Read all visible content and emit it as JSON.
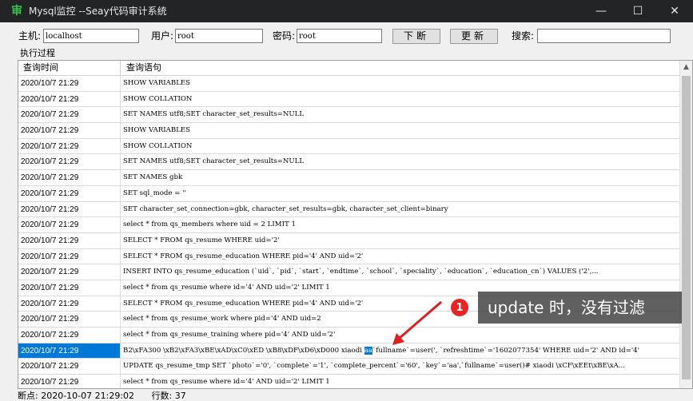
{
  "window": {
    "title": "Mysql监控 --Seay代码审计系统",
    "app_icon": "审",
    "minimize": "—",
    "maximize": "☐",
    "close": "✕"
  },
  "toolbar": {
    "host_label": "主机:",
    "host_value": "localhost",
    "user_label": "用户:",
    "user_value": "root",
    "password_label": "密码:",
    "password_value": "root",
    "disconnect_button": "下断",
    "update_button": "更新",
    "search_label": "搜索:",
    "search_value": ""
  },
  "section_title": "执行过程",
  "grid": {
    "columns": [
      "查询时间",
      "查询语句"
    ],
    "rows": [
      {
        "time": "2020/10/7 21:29",
        "query": "SHOW VARIABLES"
      },
      {
        "time": "2020/10/7 21:29",
        "query": "SHOW COLLATION"
      },
      {
        "time": "2020/10/7 21:29",
        "query": "SET NAMES utf8;SET character_set_results=NULL"
      },
      {
        "time": "2020/10/7 21:29",
        "query": "SHOW VARIABLES"
      },
      {
        "time": "2020/10/7 21:29",
        "query": "SHOW COLLATION"
      },
      {
        "time": "2020/10/7 21:29",
        "query": "SET NAMES utf8;SET character_set_results=NULL"
      },
      {
        "time": "2020/10/7 21:29",
        "query": "SET NAMES gbk"
      },
      {
        "time": "2020/10/7 21:29",
        "query": "SET sql_mode = ''"
      },
      {
        "time": "2020/10/7 21:29",
        "query": "SET character_set_connection=gbk, character_set_results=gbk, character_set_client=binary"
      },
      {
        "time": "2020/10/7 21:29",
        "query": "select * from qs_members where uid = 2 LIMIT 1"
      },
      {
        "time": "2020/10/7 21:29",
        "query": "SELECT * FROM qs_resume WHERE uid='2'"
      },
      {
        "time": "2020/10/7 21:29",
        "query": "SELECT * FROM qs_resume_education WHERE  pid='4' AND uid='2'"
      },
      {
        "time": "2020/10/7 21:29",
        "query": "INSERT INTO qs_resume_education (`uid`, `pid`, `start`, `endtime`, `school`, `speciality`, `education`, `education_cn`) VALUES ('2',..."
      },
      {
        "time": "2020/10/7 21:29",
        "query": "select * from qs_resume where id='4'  AND uid='2' LIMIT 1"
      },
      {
        "time": "2020/10/7 21:29",
        "query": "SELECT * FROM qs_resume_education WHERE  pid='4' AND uid='2'"
      },
      {
        "time": "2020/10/7 21:29",
        "query": "select * from qs_resume_work where pid='4' AND uid=2"
      },
      {
        "time": "2020/10/7 21:29",
        "query": "select * from qs_resume_training where pid='4' AND  uid='2'"
      },
      {
        "time": "2020/10/7 21:29",
        "query_before": "B2\\xFA300 \\xB2\\xFA3\\xBE\\xAD\\xC0\\xED \\xB8\\xDF\\xD6\\xD000 xiaodi ",
        "query_highlight": "aa",
        "query_after": "`fullname`=user(', `refreshtime`='1602077354' WHERE uid='2' AND id='4'"
      },
      {
        "time": "2020/10/7 21:29",
        "query": "UPDATE qs_resume_tmp SET `photo`='0', `complete`='1', `complete_percent`='60', `key`='aa',`fullname`=user()# xiaodi \\xCF\\xEEt\\xBE\\xA..."
      },
      {
        "time": "2020/10/7 21:29",
        "query": "select * from qs_resume where id='4' AND uid='2' LIMIT 1"
      }
    ]
  },
  "status": {
    "breakpoint": "断点: 2020-10-07 21:29:02",
    "row_count": "行数: 37"
  },
  "annotation": {
    "badge": "1",
    "text": "update 时，没有过滤",
    "color": "#e02020"
  }
}
